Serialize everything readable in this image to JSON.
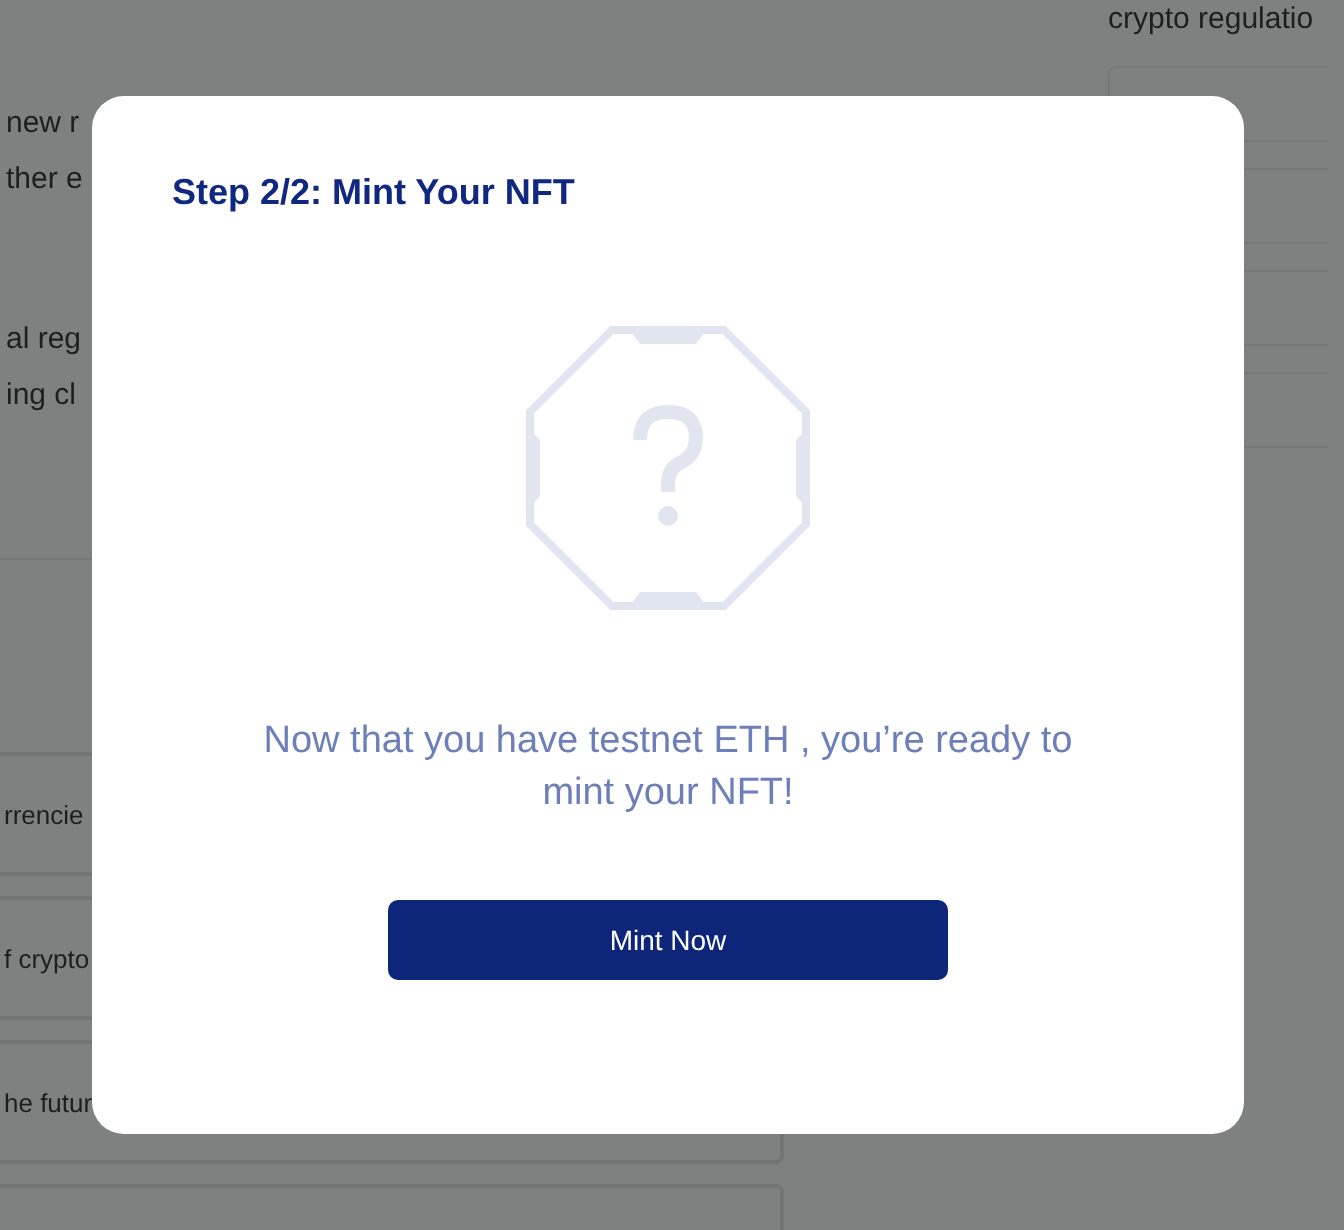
{
  "background": {
    "side_text": "crypto regulatio",
    "lines": [
      "new r",
      "ther e",
      "al reg",
      "ing cl"
    ],
    "cards": [
      "rrencie",
      "f crypto",
      "he futur"
    ]
  },
  "modal": {
    "title": "Step 2/2: Mint Your NFT",
    "message": "Now that you have testnet ETH , you’re ready to mint your NFT!",
    "button": "Mint Now"
  }
}
